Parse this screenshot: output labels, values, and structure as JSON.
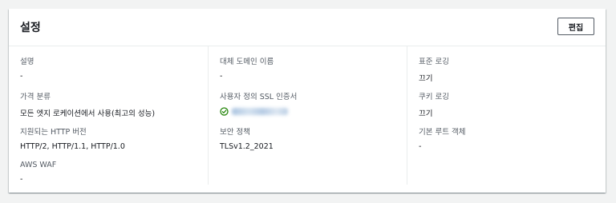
{
  "panel": {
    "title": "설정",
    "edit_label": "편집"
  },
  "column1": {
    "description": {
      "label": "설명",
      "value": "-"
    },
    "price_class": {
      "label": "가격 분류",
      "value": "모든 엣지 로케이션에서 사용(최고의 성능)"
    },
    "http_versions": {
      "label": "지원되는 HTTP 버전",
      "value": "HTTP/2, HTTP/1.1, HTTP/1.0"
    },
    "aws_waf": {
      "label": "AWS WAF",
      "value": "-"
    }
  },
  "column2": {
    "alternate_domain": {
      "label": "대체 도메인 이름",
      "value": "-"
    },
    "ssl_cert": {
      "label": "사용자 정의 SSL 인증서",
      "status_icon": "check-circle-icon",
      "status_color": "#1d8102"
    },
    "security_policy": {
      "label": "보안 정책",
      "value": "TLSv1.2_2021"
    }
  },
  "column3": {
    "standard_logging": {
      "label": "표준 로깅",
      "value": "끄기"
    },
    "cookie_logging": {
      "label": "쿠키 로깅",
      "value": "끄기"
    },
    "default_root_object": {
      "label": "기본 루트 객체",
      "value": "-"
    }
  }
}
